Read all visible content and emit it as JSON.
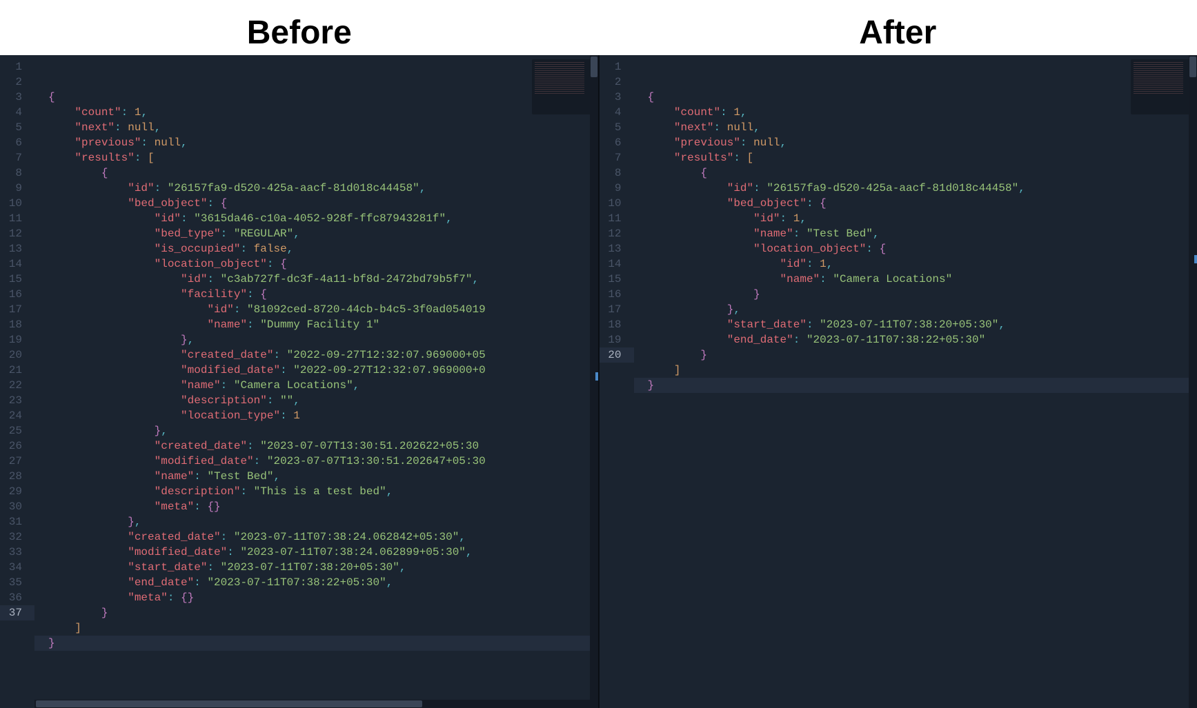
{
  "headers": {
    "before": "Before",
    "after": "After"
  },
  "left": {
    "activeLine": 37,
    "lines": [
      {
        "indent": 0,
        "tokens": [
          {
            "t": "brace",
            "v": "{"
          }
        ]
      },
      {
        "indent": 1,
        "tokens": [
          {
            "t": "key",
            "v": "\"count\""
          },
          {
            "t": "punct",
            "v": ": "
          },
          {
            "t": "num",
            "v": "1"
          },
          {
            "t": "punct",
            "v": ","
          }
        ]
      },
      {
        "indent": 1,
        "tokens": [
          {
            "t": "key",
            "v": "\"next\""
          },
          {
            "t": "punct",
            "v": ": "
          },
          {
            "t": "kw",
            "v": "null"
          },
          {
            "t": "punct",
            "v": ","
          }
        ]
      },
      {
        "indent": 1,
        "tokens": [
          {
            "t": "key",
            "v": "\"previous\""
          },
          {
            "t": "punct",
            "v": ": "
          },
          {
            "t": "kw",
            "v": "null"
          },
          {
            "t": "punct",
            "v": ","
          }
        ]
      },
      {
        "indent": 1,
        "tokens": [
          {
            "t": "key",
            "v": "\"results\""
          },
          {
            "t": "punct",
            "v": ": "
          },
          {
            "t": "bracket",
            "v": "["
          }
        ]
      },
      {
        "indent": 2,
        "tokens": [
          {
            "t": "brace",
            "v": "{"
          }
        ]
      },
      {
        "indent": 3,
        "tokens": [
          {
            "t": "key",
            "v": "\"id\""
          },
          {
            "t": "punct",
            "v": ": "
          },
          {
            "t": "str",
            "v": "\"26157fa9-d520-425a-aacf-81d018c44458\""
          },
          {
            "t": "punct",
            "v": ","
          }
        ]
      },
      {
        "indent": 3,
        "tokens": [
          {
            "t": "key",
            "v": "\"bed_object\""
          },
          {
            "t": "punct",
            "v": ": "
          },
          {
            "t": "brace",
            "v": "{"
          }
        ]
      },
      {
        "indent": 4,
        "tokens": [
          {
            "t": "key",
            "v": "\"id\""
          },
          {
            "t": "punct",
            "v": ": "
          },
          {
            "t": "str",
            "v": "\"3615da46-c10a-4052-928f-ffc87943281f\""
          },
          {
            "t": "punct",
            "v": ","
          }
        ]
      },
      {
        "indent": 4,
        "tokens": [
          {
            "t": "key",
            "v": "\"bed_type\""
          },
          {
            "t": "punct",
            "v": ": "
          },
          {
            "t": "str",
            "v": "\"REGULAR\""
          },
          {
            "t": "punct",
            "v": ","
          }
        ]
      },
      {
        "indent": 4,
        "tokens": [
          {
            "t": "key",
            "v": "\"is_occupied\""
          },
          {
            "t": "punct",
            "v": ": "
          },
          {
            "t": "kw",
            "v": "false"
          },
          {
            "t": "punct",
            "v": ","
          }
        ]
      },
      {
        "indent": 4,
        "tokens": [
          {
            "t": "key",
            "v": "\"location_object\""
          },
          {
            "t": "punct",
            "v": ": "
          },
          {
            "t": "brace",
            "v": "{"
          }
        ]
      },
      {
        "indent": 5,
        "tokens": [
          {
            "t": "key",
            "v": "\"id\""
          },
          {
            "t": "punct",
            "v": ": "
          },
          {
            "t": "str",
            "v": "\"c3ab727f-dc3f-4a11-bf8d-2472bd79b5f7\""
          },
          {
            "t": "punct",
            "v": ","
          }
        ]
      },
      {
        "indent": 5,
        "tokens": [
          {
            "t": "key",
            "v": "\"facility\""
          },
          {
            "t": "punct",
            "v": ": "
          },
          {
            "t": "brace",
            "v": "{"
          }
        ]
      },
      {
        "indent": 6,
        "tokens": [
          {
            "t": "key",
            "v": "\"id\""
          },
          {
            "t": "punct",
            "v": ": "
          },
          {
            "t": "str",
            "v": "\"81092ced-8720-44cb-b4c5-3f0ad054019"
          }
        ]
      },
      {
        "indent": 6,
        "tokens": [
          {
            "t": "key",
            "v": "\"name\""
          },
          {
            "t": "punct",
            "v": ": "
          },
          {
            "t": "str",
            "v": "\"Dummy Facility 1\""
          }
        ]
      },
      {
        "indent": 5,
        "tokens": [
          {
            "t": "brace",
            "v": "}"
          },
          {
            "t": "punct",
            "v": ","
          }
        ]
      },
      {
        "indent": 5,
        "tokens": [
          {
            "t": "key",
            "v": "\"created_date\""
          },
          {
            "t": "punct",
            "v": ": "
          },
          {
            "t": "str",
            "v": "\"2022-09-27T12:32:07.969000+05"
          }
        ]
      },
      {
        "indent": 5,
        "tokens": [
          {
            "t": "key",
            "v": "\"modified_date\""
          },
          {
            "t": "punct",
            "v": ": "
          },
          {
            "t": "str",
            "v": "\"2022-09-27T12:32:07.969000+0"
          }
        ]
      },
      {
        "indent": 5,
        "tokens": [
          {
            "t": "key",
            "v": "\"name\""
          },
          {
            "t": "punct",
            "v": ": "
          },
          {
            "t": "str",
            "v": "\"Camera Locations\""
          },
          {
            "t": "punct",
            "v": ","
          }
        ]
      },
      {
        "indent": 5,
        "tokens": [
          {
            "t": "key",
            "v": "\"description\""
          },
          {
            "t": "punct",
            "v": ": "
          },
          {
            "t": "str",
            "v": "\"\""
          },
          {
            "t": "punct",
            "v": ","
          }
        ]
      },
      {
        "indent": 5,
        "tokens": [
          {
            "t": "key",
            "v": "\"location_type\""
          },
          {
            "t": "punct",
            "v": ": "
          },
          {
            "t": "num",
            "v": "1"
          }
        ]
      },
      {
        "indent": 4,
        "tokens": [
          {
            "t": "brace",
            "v": "}"
          },
          {
            "t": "punct",
            "v": ","
          }
        ]
      },
      {
        "indent": 4,
        "tokens": [
          {
            "t": "key",
            "v": "\"created_date\""
          },
          {
            "t": "punct",
            "v": ": "
          },
          {
            "t": "str",
            "v": "\"2023-07-07T13:30:51.202622+05:30"
          }
        ]
      },
      {
        "indent": 4,
        "tokens": [
          {
            "t": "key",
            "v": "\"modified_date\""
          },
          {
            "t": "punct",
            "v": ": "
          },
          {
            "t": "str",
            "v": "\"2023-07-07T13:30:51.202647+05:30"
          }
        ]
      },
      {
        "indent": 4,
        "tokens": [
          {
            "t": "key",
            "v": "\"name\""
          },
          {
            "t": "punct",
            "v": ": "
          },
          {
            "t": "str",
            "v": "\"Test Bed\""
          },
          {
            "t": "punct",
            "v": ","
          }
        ]
      },
      {
        "indent": 4,
        "tokens": [
          {
            "t": "key",
            "v": "\"description\""
          },
          {
            "t": "punct",
            "v": ": "
          },
          {
            "t": "str",
            "v": "\"This is a test bed\""
          },
          {
            "t": "punct",
            "v": ","
          }
        ]
      },
      {
        "indent": 4,
        "tokens": [
          {
            "t": "key",
            "v": "\"meta\""
          },
          {
            "t": "punct",
            "v": ": "
          },
          {
            "t": "brace",
            "v": "{}"
          }
        ]
      },
      {
        "indent": 3,
        "tokens": [
          {
            "t": "brace",
            "v": "}"
          },
          {
            "t": "punct",
            "v": ","
          }
        ]
      },
      {
        "indent": 3,
        "tokens": [
          {
            "t": "key",
            "v": "\"created_date\""
          },
          {
            "t": "punct",
            "v": ": "
          },
          {
            "t": "str",
            "v": "\"2023-07-11T07:38:24.062842+05:30\""
          },
          {
            "t": "punct",
            "v": ","
          }
        ]
      },
      {
        "indent": 3,
        "tokens": [
          {
            "t": "key",
            "v": "\"modified_date\""
          },
          {
            "t": "punct",
            "v": ": "
          },
          {
            "t": "str",
            "v": "\"2023-07-11T07:38:24.062899+05:30\""
          },
          {
            "t": "punct",
            "v": ","
          }
        ]
      },
      {
        "indent": 3,
        "tokens": [
          {
            "t": "key",
            "v": "\"start_date\""
          },
          {
            "t": "punct",
            "v": ": "
          },
          {
            "t": "str",
            "v": "\"2023-07-11T07:38:20+05:30\""
          },
          {
            "t": "punct",
            "v": ","
          }
        ]
      },
      {
        "indent": 3,
        "tokens": [
          {
            "t": "key",
            "v": "\"end_date\""
          },
          {
            "t": "punct",
            "v": ": "
          },
          {
            "t": "str",
            "v": "\"2023-07-11T07:38:22+05:30\""
          },
          {
            "t": "punct",
            "v": ","
          }
        ]
      },
      {
        "indent": 3,
        "tokens": [
          {
            "t": "key",
            "v": "\"meta\""
          },
          {
            "t": "punct",
            "v": ": "
          },
          {
            "t": "brace",
            "v": "{}"
          }
        ]
      },
      {
        "indent": 2,
        "tokens": [
          {
            "t": "brace",
            "v": "}"
          }
        ]
      },
      {
        "indent": 1,
        "tokens": [
          {
            "t": "bracket",
            "v": "]"
          }
        ]
      },
      {
        "indent": 0,
        "tokens": [
          {
            "t": "brace",
            "v": "}"
          }
        ]
      }
    ]
  },
  "right": {
    "activeLine": 20,
    "lines": [
      {
        "indent": 0,
        "tokens": [
          {
            "t": "brace",
            "v": "{"
          }
        ]
      },
      {
        "indent": 1,
        "tokens": [
          {
            "t": "key",
            "v": "\"count\""
          },
          {
            "t": "punct",
            "v": ": "
          },
          {
            "t": "num",
            "v": "1"
          },
          {
            "t": "punct",
            "v": ","
          }
        ]
      },
      {
        "indent": 1,
        "tokens": [
          {
            "t": "key",
            "v": "\"next\""
          },
          {
            "t": "punct",
            "v": ": "
          },
          {
            "t": "kw",
            "v": "null"
          },
          {
            "t": "punct",
            "v": ","
          }
        ]
      },
      {
        "indent": 1,
        "tokens": [
          {
            "t": "key",
            "v": "\"previous\""
          },
          {
            "t": "punct",
            "v": ": "
          },
          {
            "t": "kw",
            "v": "null"
          },
          {
            "t": "punct",
            "v": ","
          }
        ]
      },
      {
        "indent": 1,
        "tokens": [
          {
            "t": "key",
            "v": "\"results\""
          },
          {
            "t": "punct",
            "v": ": "
          },
          {
            "t": "bracket",
            "v": "["
          }
        ]
      },
      {
        "indent": 2,
        "tokens": [
          {
            "t": "brace",
            "v": "{"
          }
        ]
      },
      {
        "indent": 3,
        "tokens": [
          {
            "t": "key",
            "v": "\"id\""
          },
          {
            "t": "punct",
            "v": ": "
          },
          {
            "t": "str",
            "v": "\"26157fa9-d520-425a-aacf-81d018c44458\""
          },
          {
            "t": "punct",
            "v": ","
          }
        ]
      },
      {
        "indent": 3,
        "tokens": [
          {
            "t": "key",
            "v": "\"bed_object\""
          },
          {
            "t": "punct",
            "v": ": "
          },
          {
            "t": "brace",
            "v": "{"
          }
        ]
      },
      {
        "indent": 4,
        "tokens": [
          {
            "t": "key",
            "v": "\"id\""
          },
          {
            "t": "punct",
            "v": ": "
          },
          {
            "t": "num",
            "v": "1"
          },
          {
            "t": "punct",
            "v": ","
          }
        ]
      },
      {
        "indent": 4,
        "tokens": [
          {
            "t": "key",
            "v": "\"name\""
          },
          {
            "t": "punct",
            "v": ": "
          },
          {
            "t": "str",
            "v": "\"Test Bed\""
          },
          {
            "t": "punct",
            "v": ","
          }
        ]
      },
      {
        "indent": 4,
        "tokens": [
          {
            "t": "key",
            "v": "\"location_object\""
          },
          {
            "t": "punct",
            "v": ": "
          },
          {
            "t": "brace",
            "v": "{"
          }
        ]
      },
      {
        "indent": 5,
        "tokens": [
          {
            "t": "key",
            "v": "\"id\""
          },
          {
            "t": "punct",
            "v": ": "
          },
          {
            "t": "num",
            "v": "1"
          },
          {
            "t": "punct",
            "v": ","
          }
        ]
      },
      {
        "indent": 5,
        "tokens": [
          {
            "t": "key",
            "v": "\"name\""
          },
          {
            "t": "punct",
            "v": ": "
          },
          {
            "t": "str",
            "v": "\"Camera Locations\""
          }
        ]
      },
      {
        "indent": 4,
        "tokens": [
          {
            "t": "brace",
            "v": "}"
          }
        ]
      },
      {
        "indent": 3,
        "tokens": [
          {
            "t": "brace",
            "v": "}"
          },
          {
            "t": "punct",
            "v": ","
          }
        ]
      },
      {
        "indent": 3,
        "tokens": [
          {
            "t": "key",
            "v": "\"start_date\""
          },
          {
            "t": "punct",
            "v": ": "
          },
          {
            "t": "str",
            "v": "\"2023-07-11T07:38:20+05:30\""
          },
          {
            "t": "punct",
            "v": ","
          }
        ]
      },
      {
        "indent": 3,
        "tokens": [
          {
            "t": "key",
            "v": "\"end_date\""
          },
          {
            "t": "punct",
            "v": ": "
          },
          {
            "t": "str",
            "v": "\"2023-07-11T07:38:22+05:30\""
          }
        ]
      },
      {
        "indent": 2,
        "tokens": [
          {
            "t": "brace",
            "v": "}"
          }
        ]
      },
      {
        "indent": 1,
        "tokens": [
          {
            "t": "bracket",
            "v": "]"
          }
        ]
      },
      {
        "indent": 0,
        "tokens": [
          {
            "t": "brace",
            "v": "}"
          }
        ]
      }
    ]
  }
}
